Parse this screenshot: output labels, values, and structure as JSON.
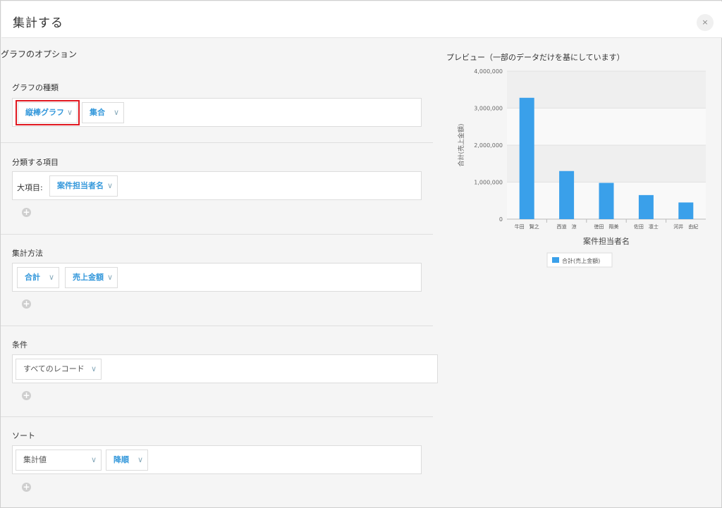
{
  "dialog": {
    "title": "集計する",
    "close_label": "×"
  },
  "options_title": "グラフのオプション",
  "graph_type": {
    "label": "グラフの種類",
    "type_value": "縦棒グラフ",
    "mode_value": "集合"
  },
  "grouping": {
    "label": "分類する項目",
    "major_label": "大項目:",
    "major_value": "案件担当者名"
  },
  "aggregation": {
    "label": "集計方法",
    "func_value": "合計",
    "field_value": "売上金額"
  },
  "condition": {
    "label": "条件",
    "value": "すべてのレコード"
  },
  "sort": {
    "label": "ソート",
    "by_value": "集計値",
    "order_value": "降順"
  },
  "add_icon": "+",
  "chevron": "∨",
  "preview": {
    "title": "プレビュー（一部のデータだけを基にしています）"
  },
  "chart_data": {
    "type": "bar",
    "categories": [
      "牛田　賢之",
      "西道　涼",
      "徳田　翔美",
      "佐田　凛士",
      "河井　由紀"
    ],
    "series": [
      {
        "name": "合計(売上金額)",
        "values": [
          3280000,
          1300000,
          980000,
          650000,
          450000
        ]
      }
    ],
    "xlabel": "案件担当者名",
    "ylabel": "合計(売上金額)",
    "ylim": [
      0,
      4000000
    ],
    "yticks": [
      "0",
      "1,000,000",
      "2,000,000",
      "3,000,000",
      "4,000,000"
    ],
    "bar_color": "#3aa0ea",
    "legend_position": "bottom",
    "grid": true
  }
}
